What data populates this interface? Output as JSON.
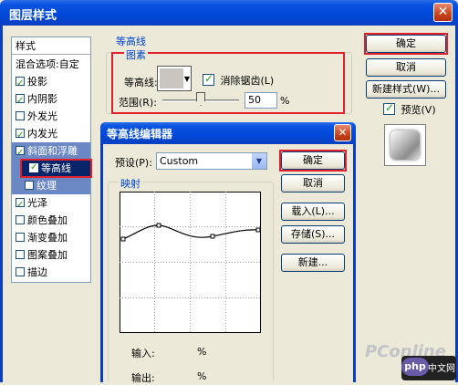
{
  "window": {
    "title": "图层样式",
    "close": "✕"
  },
  "style_list": {
    "header": "样式",
    "items": [
      {
        "label": "混合选项:自定",
        "checkbox": false,
        "checked": false
      },
      {
        "label": "投影",
        "checkbox": true,
        "checked": true
      },
      {
        "label": "内阴影",
        "checkbox": true,
        "checked": true
      },
      {
        "label": "外发光",
        "checkbox": true,
        "checked": false
      },
      {
        "label": "内发光",
        "checkbox": true,
        "checked": true
      },
      {
        "label": "斜面和浮雕",
        "checkbox": true,
        "checked": true
      },
      {
        "label": "等高线",
        "checkbox": true,
        "checked": true
      },
      {
        "label": "纹理",
        "checkbox": true,
        "checked": false
      },
      {
        "label": "光泽",
        "checkbox": true,
        "checked": true
      },
      {
        "label": "颜色叠加",
        "checkbox": true,
        "checked": false
      },
      {
        "label": "渐变叠加",
        "checkbox": true,
        "checked": false
      },
      {
        "label": "图案叠加",
        "checkbox": true,
        "checked": false
      },
      {
        "label": "描边",
        "checkbox": true,
        "checked": false
      }
    ]
  },
  "contour_panel": {
    "section_title": "等高线",
    "group_title": "图素",
    "contour_label": "等高线:",
    "antialias_label": "消除锯齿(L)",
    "range_label": "范围(R):",
    "range_value": "50",
    "range_unit": "%"
  },
  "right_buttons": {
    "ok": "确定",
    "cancel": "取消",
    "new_style": "新建样式(W)...",
    "preview": "预览(V)"
  },
  "contour_editor": {
    "title": "等高线编辑器",
    "preset_label": "预设(P):",
    "preset_value": "Custom",
    "mapping_label": "映射",
    "input_label": "输入:",
    "input_unit": "%",
    "output_label": "输出:",
    "output_unit": "%",
    "buttons": {
      "ok": "确定",
      "cancel": "取消",
      "load": "载入(L)...",
      "save": "存储(S)...",
      "new": "新建..."
    }
  },
  "watermarks": {
    "pconline": "PConline",
    "php": "php",
    "php_suffix": "中文网"
  }
}
